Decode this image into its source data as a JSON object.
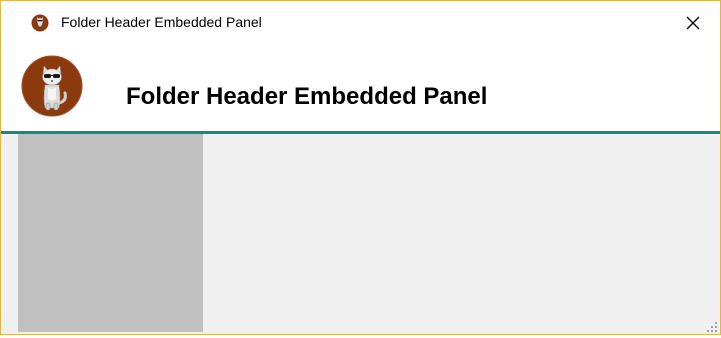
{
  "window": {
    "title": "Folder Header Embedded Panel",
    "title_icon": "app-cat-icon",
    "close_icon": "close-icon"
  },
  "header": {
    "title": "Folder Header Embedded Panel",
    "logo": "cat-logo-icon"
  },
  "colors": {
    "accent": "#0f8c83",
    "window_border": "#e0b84a",
    "logo_bg": "#8b3a0e",
    "left_pane": "#c0c0c0",
    "content_bg": "#f0f0f0"
  }
}
